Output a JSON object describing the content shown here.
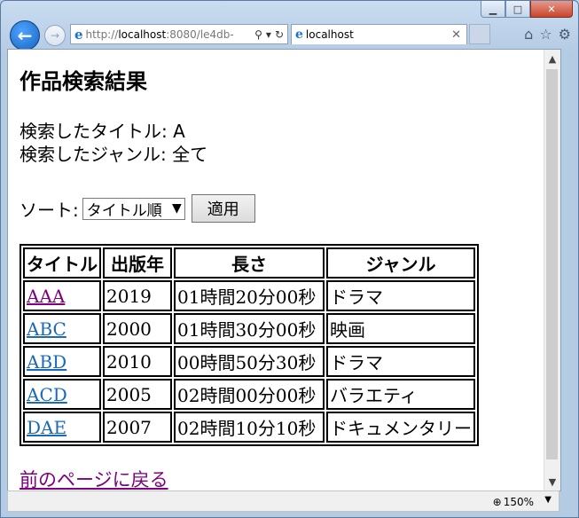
{
  "browser": {
    "address": {
      "prefix": "http://",
      "host": "localhost",
      "rest": ":8080/le4db-"
    },
    "tab_title": "localhost",
    "zoom": "150%"
  },
  "page": {
    "heading": "作品検索結果",
    "searched_title_line": "検索したタイトル: A",
    "searched_genre_line": "検索したジャンル: 全て",
    "sort_label": "ソート:",
    "sort_selected": "タイトル順",
    "apply_label": "適用",
    "table": {
      "headers": [
        "タイトル",
        "出版年",
        "長さ",
        "ジャンル"
      ],
      "rows": [
        {
          "title": "AAA",
          "year": "2019",
          "length": "01時間20分00秒",
          "genre": "ドラマ"
        },
        {
          "title": "ABC",
          "year": "2000",
          "length": "01時間30分00秒",
          "genre": "映画"
        },
        {
          "title": "ABD",
          "year": "2010",
          "length": "00時間50分30秒",
          "genre": "ドラマ"
        },
        {
          "title": "ACD",
          "year": "2005",
          "length": "02時間00分00秒",
          "genre": "バラエティ"
        },
        {
          "title": "DAE",
          "year": "2007",
          "length": "02時間10分10秒",
          "genre": "ドキュメンタリー"
        }
      ]
    },
    "back_link": "前のページに戻る"
  }
}
